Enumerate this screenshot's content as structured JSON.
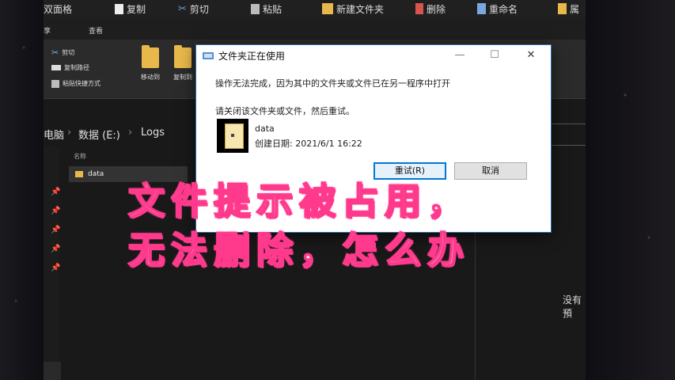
{
  "topbar": {
    "items": [
      "双面格",
      "复制",
      "剪切",
      "粘贴",
      "新建文件夹",
      "删除",
      "重命名",
      "属"
    ]
  },
  "tabs": {
    "share": "享",
    "view": "查看"
  },
  "ribbon": {
    "cut": "剪切",
    "copy_path": "复制路径",
    "paste_shortcut": "粘贴快捷方式",
    "move_to": "移动到",
    "copy_to": "复制到"
  },
  "address": {
    "computer": "电脑",
    "drive": "数据 (E:)",
    "folder": "Logs"
  },
  "file_list": {
    "header": "名称",
    "rows": [
      "data"
    ]
  },
  "right_panel": {
    "text": "没有預"
  },
  "dialog": {
    "title": "文件夹正在使用",
    "message": "操作无法完成，因为其中的文件夹或文件已在另一程序中打开",
    "instruction": "请关闭该文件夹或文件，然后重试。",
    "file_name": "data",
    "file_date": "创建日期: 2021/6/1 16:22",
    "retry_label": "重试(R)",
    "cancel_label": "取消",
    "minimize": "—",
    "maximize": "☐",
    "close": "✕"
  },
  "caption": {
    "line1": "文件提示被占用，",
    "line2": "无法删除，怎么办"
  },
  "colors": {
    "caption_fill": "#f0f2f5",
    "caption_outline": "#ff3a8c",
    "accent": "#0078d7",
    "folder": "#e8b84a",
    "explorer_bg": "#191919"
  }
}
